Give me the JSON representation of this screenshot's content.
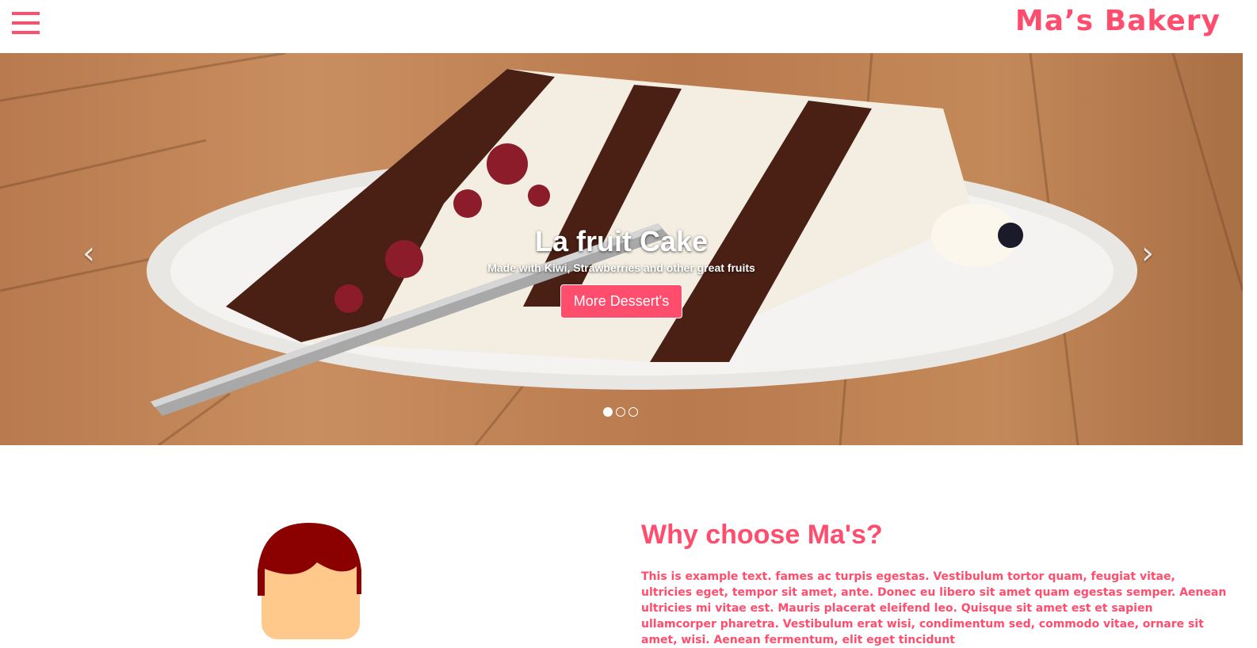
{
  "header": {
    "brand": "Ma’s Bakery",
    "menu_icon": "hamburger-menu-icon"
  },
  "carousel": {
    "title": "La fruit Cake",
    "subtitle": "Made with Kiwi, Strawberries and other great fruits",
    "button_label": "More Dessert's",
    "prev_icon": "chevron-left-icon",
    "next_icon": "chevron-right-icon",
    "prev_glyph": "‹",
    "next_glyph": "›",
    "slides_count": 3,
    "active_slide": 1
  },
  "why": {
    "title": "Why choose Ma's?",
    "text": "This is example text. fames ac turpis egestas. Vestibulum tortor quam, feugiat vitae, ultricies eget, tempor sit amet, ante. Donec eu libero sit amet quam egestas semper. Aenean ultricies mi vitae est. Mauris placerat eleifend leo. Quisque sit amet est et sapien ullamcorper pharetra. Vestibulum erat wisi, condimentum sed, commodo vitae, ornare sit amet, wisi. Aenean fermentum, elit eget tincidunt"
  },
  "colors": {
    "accent": "#ff4d6d",
    "white": "#ffffff"
  }
}
